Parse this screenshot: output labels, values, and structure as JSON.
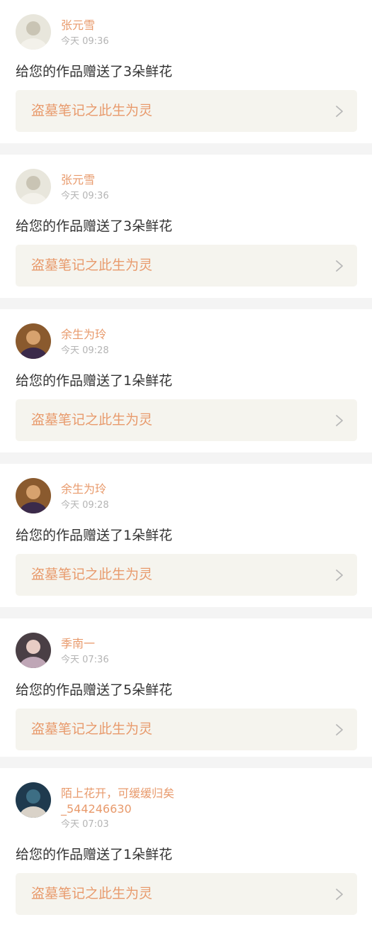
{
  "notifications": [
    {
      "user": "张元雪",
      "time": "今天 09:36",
      "message": "给您的作品赠送了3朵鲜花",
      "work": "盗墓笔记之此生为灵",
      "avatar_palette": [
        "#e8e6dc",
        "#c9c4b4",
        "#f3f1ea"
      ]
    },
    {
      "user": "张元雪",
      "time": "今天 09:36",
      "message": "给您的作品赠送了3朵鲜花",
      "work": "盗墓笔记之此生为灵",
      "avatar_palette": [
        "#e8e6dc",
        "#c9c4b4",
        "#f3f1ea"
      ]
    },
    {
      "user": "余生为玲",
      "time": "今天 09:28",
      "message": "给您的作品赠送了1朵鲜花",
      "work": "盗墓笔记之此生为灵",
      "avatar_palette": [
        "#8a5a2e",
        "#d7a26e",
        "#3b2a4a"
      ]
    },
    {
      "user": "余生为玲",
      "time": "今天 09:28",
      "message": "给您的作品赠送了1朵鲜花",
      "work": "盗墓笔记之此生为灵",
      "avatar_palette": [
        "#8a5a2e",
        "#d7a26e",
        "#3b2a4a"
      ]
    },
    {
      "user": "季南一",
      "time": "今天 07:36",
      "message": "给您的作品赠送了5朵鲜花",
      "work": "盗墓笔记之此生为灵",
      "avatar_palette": [
        "#4a3f45",
        "#e8ccc4",
        "#bfa6b6"
      ]
    },
    {
      "user": "陌上花开，可缓缓归矣_544246630",
      "time": "今天 07:03",
      "message": "给您的作品赠送了1朵鲜花",
      "work": "盗墓笔记之此生为灵",
      "avatar_palette": [
        "#1f3a4e",
        "#3d6e84",
        "#d9d2c8"
      ]
    }
  ],
  "colors": {
    "username": "#e89a6c",
    "work_title": "#e89a6c",
    "time": "#b4b4b4",
    "message": "#333333",
    "work_bg": "#f5f4ee",
    "separator": "#f4f4f4"
  },
  "icons": {
    "item_arrow": "chevron-right-icon"
  }
}
